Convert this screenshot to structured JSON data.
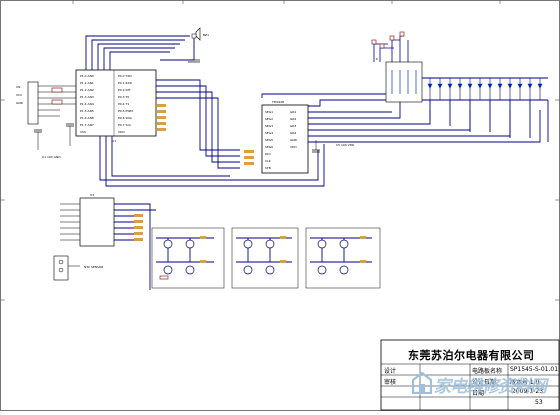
{
  "title_block": {
    "company": "东莞苏泊尔电器有限公司",
    "row1_left": "电路板名称",
    "row1_right": "SP1545-S-01.01",
    "row2_left_a": "设计",
    "row2_left_b": "审核",
    "row2_mid": "设计日期",
    "row2_right": "版本号 1.0",
    "row3_left": "日期",
    "row3_right": "2009-1-23",
    "row4_right": "53"
  },
  "watermark": {
    "text": "家电维修资料网",
    "icon": "watermark-logo-icon"
  },
  "colors": {
    "wire": "#000080",
    "part_outline": "#7a0000",
    "part_label": "#d8a040",
    "led": "#0033cc",
    "net_label": "#8b6914",
    "watermark": "#9ec0de"
  }
}
